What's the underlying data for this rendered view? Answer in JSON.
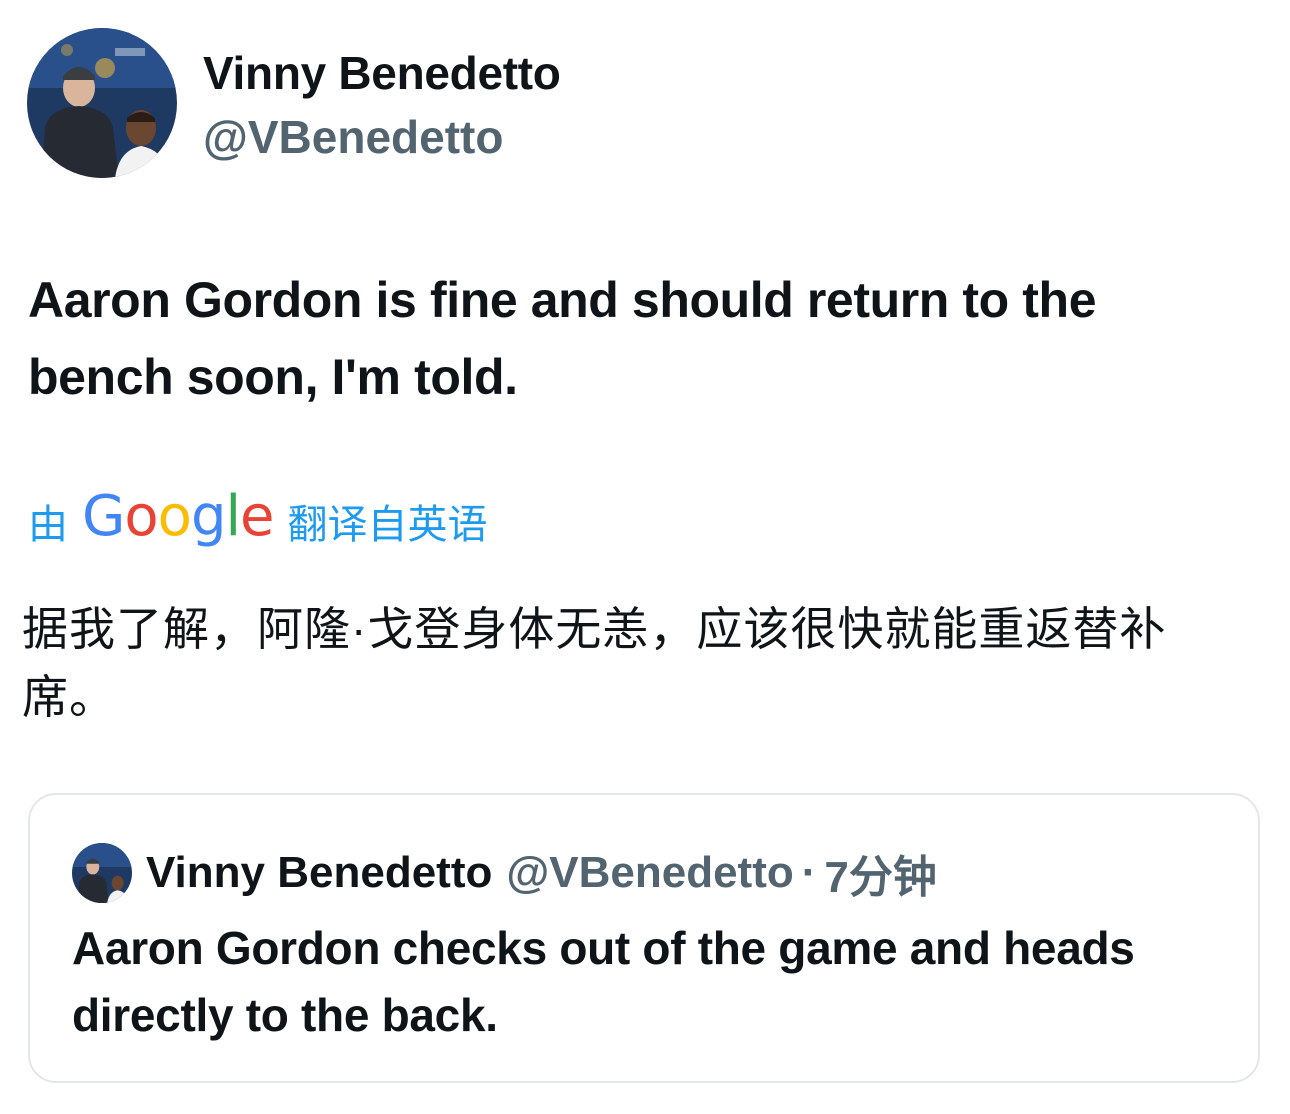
{
  "author": {
    "display_name": "Vinny Benedetto",
    "handle": "@VBenedetto",
    "avatar_icon": "profile-photo"
  },
  "tweet": {
    "text": "Aaron Gordon is fine and should return to the bench soon, I'm told."
  },
  "translation": {
    "prefix": "由",
    "provider": "Google",
    "suffix": "翻译自英语",
    "text": "据我了解，阿隆·戈登身体无恙，应该很快就能重返替补席。"
  },
  "quoted_tweet": {
    "display_name": "Vinny Benedetto",
    "handle": "@VBenedetto",
    "separator": "·",
    "time": "7分钟",
    "text": "Aaron Gordon checks out of the game and heads directly to the back."
  },
  "colors": {
    "link_blue": "#1d9bf0",
    "secondary_text": "#536471",
    "primary_text": "#0f1419",
    "card_border": "#e3e7ea"
  }
}
